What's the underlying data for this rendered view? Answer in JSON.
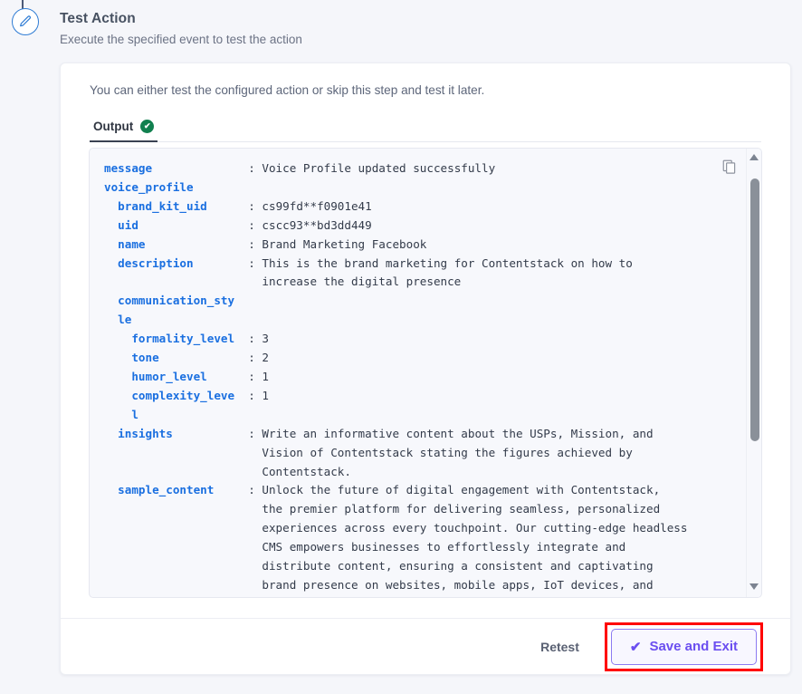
{
  "header": {
    "title": "Test Action",
    "subtitle": "Execute the specified event to test the action",
    "step_icon": "pencil-edit-icon"
  },
  "card": {
    "intro": "You can either test the configured action or skip this step and test it later."
  },
  "tabs": [
    {
      "label": "Output",
      "status_icon": "green-check-icon",
      "active": true
    }
  ],
  "output": {
    "copy_icon": "copy-icon",
    "scrollbar": {
      "up_arrow_icon": "scroll-up-arrow-icon",
      "down_arrow_icon": "scroll-down-arrow-icon"
    },
    "lines": [
      {
        "key": "message",
        "indent": 0,
        "value": "Voice Profile updated successfully"
      },
      {
        "key": "voice_profile",
        "indent": 0,
        "value": null
      },
      {
        "key": "brand_kit_uid",
        "indent": 1,
        "value": "cs99fd**f0901e41"
      },
      {
        "key": "uid",
        "indent": 1,
        "value": "cscc93**bd3dd449"
      },
      {
        "key": "name",
        "indent": 1,
        "value": "Brand Marketing Facebook"
      },
      {
        "key": "description",
        "indent": 1,
        "value": "This is the brand marketing for Contentstack on how to increase the digital presence"
      },
      {
        "key": "communication_style",
        "indent": 1,
        "value": null
      },
      {
        "key": "formality_level",
        "indent": 2,
        "value": "3"
      },
      {
        "key": "tone",
        "indent": 2,
        "value": "2"
      },
      {
        "key": "humor_level",
        "indent": 2,
        "value": "1"
      },
      {
        "key": "complexity_level",
        "indent": 2,
        "value": "1"
      },
      {
        "key": "insights",
        "indent": 1,
        "value": "Write an informative content about the USPs, Mission, and Vision of Contentstack stating the figures achieved by Contentstack."
      },
      {
        "key": "sample_content",
        "indent": 1,
        "value": "Unlock the future of digital engagement with Contentstack, the premier platform for delivering seamless, personalized experiences across every touchpoint. Our cutting-edge headless CMS empowers businesses to effortlessly integrate and distribute content, ensuring a consistent and captivating brand presence on websites, mobile apps, IoT devices, and emerging technologies. With unparalleled scalability,"
      }
    ],
    "rendered_text": "message              : Voice Profile updated successfully\nvoice_profile\n  brand_kit_uid      : cs99fd**f0901e41\n  uid                : cscc93**bd3dd449\n  name               : Brand Marketing Facebook\n  description        : This is the brand marketing for Contentstack on how to\n                       increase the digital presence\n  communication_sty\n  le\n    formality_level  : 3\n    tone             : 2\n    humor_level      : 1\n    complexity_leve  : 1\n    l\n  insights           : Write an informative content about the USPs, Mission, and\n                       Vision of Contentstack stating the figures achieved by\n                       Contentstack.\n  sample_content     : Unlock the future of digital engagement with Contentstack,\n                       the premier platform for delivering seamless, personalized\n                       experiences across every touchpoint. Our cutting-edge headless\n                       CMS empowers businesses to effortlessly integrate and\n                       distribute content, ensuring a consistent and captivating\n                       brand presence on websites, mobile apps, IoT devices, and\n                       emerging technologies. With unparalleled scalability,"
  },
  "footer": {
    "retest_label": "Retest",
    "save_label": "Save and Exit",
    "save_icon": "check-icon",
    "highlight_color": "#ff0000"
  },
  "colors": {
    "page_background": "#f5f6fa",
    "card_background": "#ffffff",
    "code_background": "#f7f8fc",
    "key_blue": "#1a6fe0",
    "accent_purple": "#6b4ef0",
    "status_green": "#11804f",
    "step_blue": "#2f7cd4"
  }
}
